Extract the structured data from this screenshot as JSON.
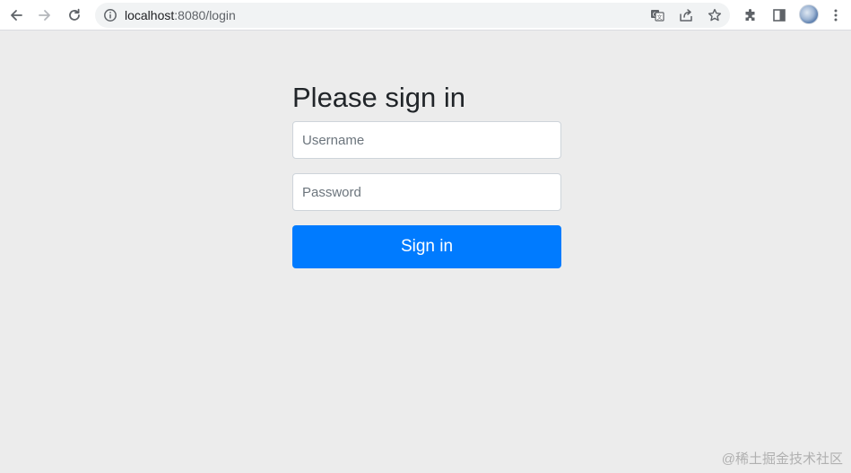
{
  "browser": {
    "url_host": "localhost",
    "url_rest": ":8080/login",
    "icons": {
      "back": "back-arrow-icon",
      "forward": "forward-arrow-icon",
      "reload": "reload-icon",
      "site_info": "info-icon",
      "translate": "translate-icon",
      "share": "share-icon",
      "bookmark": "star-icon",
      "extensions": "puzzle-icon",
      "side_panel": "side-panel-icon",
      "menu": "kebab-menu-icon"
    }
  },
  "login": {
    "heading": "Please sign in",
    "username_placeholder": "Username",
    "username_value": "",
    "password_placeholder": "Password",
    "password_value": "",
    "submit_label": "Sign in"
  },
  "colors": {
    "page_background": "#ececec",
    "primary_button": "#007bff",
    "heading_text": "#212529"
  },
  "watermark": "@稀土掘金技术社区"
}
